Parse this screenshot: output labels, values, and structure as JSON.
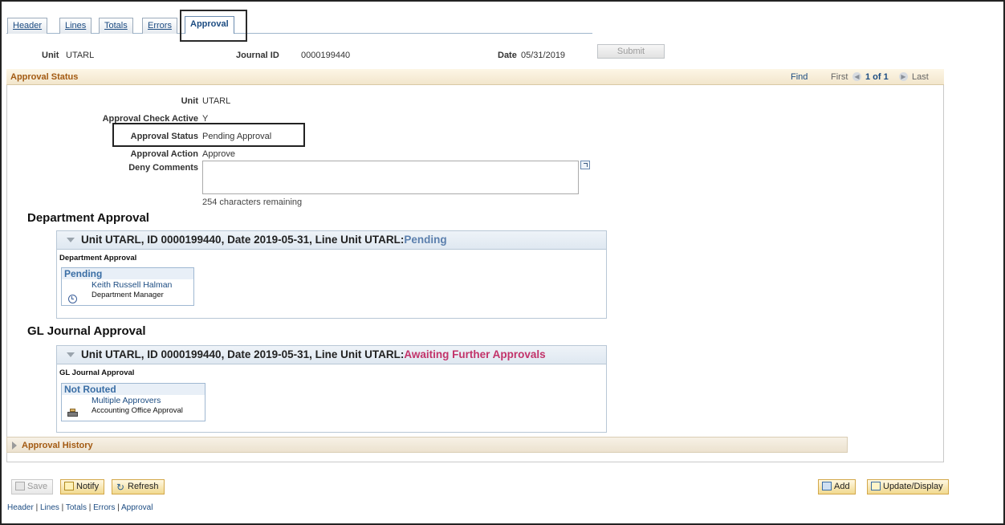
{
  "tabs": [
    {
      "label": "Header"
    },
    {
      "label": "Lines"
    },
    {
      "label": "Totals"
    },
    {
      "label": "Errors"
    },
    {
      "label": "Approval"
    }
  ],
  "header": {
    "unit_label": "Unit",
    "unit_value": "UTARL",
    "journal_label": "Journal ID",
    "journal_value": "0000199440",
    "date_label": "Date",
    "date_value": "05/31/2019",
    "submit_label": "Submit"
  },
  "approval_status_group": {
    "title": "Approval Status",
    "find": "Find",
    "first": "First",
    "count": "1 of 1",
    "last": "Last",
    "fields": {
      "unit_label": "Unit",
      "unit_value": "UTARL",
      "check_active_label": "Approval Check Active",
      "check_active_value": "Y",
      "status_label": "Approval Status",
      "status_value": "Pending Approval",
      "action_label": "Approval Action",
      "action_value": "Approve",
      "deny_label": "Deny Comments",
      "chars_remaining": "254 characters remaining"
    }
  },
  "department_approval": {
    "section_title": "Department Approval",
    "header_prefix": "Unit UTARL, ID 0000199440, Date 2019-05-31, Line Unit UTARL:",
    "header_status": "Pending",
    "sub_title": "Department Approval",
    "approver_state": "Pending",
    "approver_name": "Keith Russell Halman",
    "approver_role": "Department Manager"
  },
  "gl_approval": {
    "section_title": "GL Journal Approval",
    "header_prefix": "Unit UTARL, ID 0000199440, Date 2019-05-31, Line Unit UTARL:",
    "header_status": "Awaiting Further Approvals",
    "sub_title": "GL Journal Approval",
    "approver_state": "Not Routed",
    "approver_name": "Multiple Approvers",
    "approver_role": "Accounting Office Approval"
  },
  "history": {
    "title": "Approval History"
  },
  "toolbar": {
    "save": "Save",
    "notify": "Notify",
    "refresh": "Refresh",
    "add": "Add",
    "update": "Update/Display"
  },
  "bottom_links": {
    "header": "Header",
    "lines": "Lines",
    "totals": "Totals",
    "errors": "Errors",
    "approval": "Approval",
    "sep": " | "
  },
  "colors": {
    "pending": "#5b7fad",
    "awaiting": "#c2336a",
    "group_title": "#a35a12",
    "link": "#1c4c82"
  }
}
